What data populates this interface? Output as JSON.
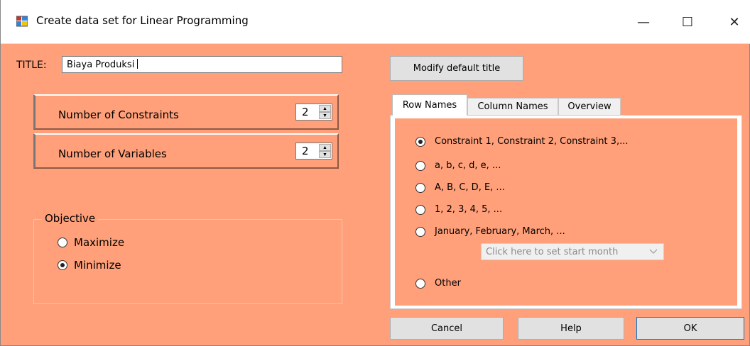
{
  "window": {
    "title": "Create data set for Linear Programming",
    "controls": {
      "minimize": "—",
      "maximize": "☐",
      "close": "✕"
    }
  },
  "title_field": {
    "label": "TITLE:",
    "value": "Biaya Produksi"
  },
  "modify_button": "Modify default title",
  "constraints": {
    "label": "Number of Constraints",
    "value": "2"
  },
  "variables": {
    "label": "Number of Variables",
    "value": "2"
  },
  "objective": {
    "legend": "Objective",
    "options": [
      {
        "label": "Maximize",
        "selected": false
      },
      {
        "label": "Minimize",
        "selected": true
      }
    ]
  },
  "tabs": [
    {
      "label": "Row Names",
      "active": true
    },
    {
      "label": "Column Names",
      "active": false
    },
    {
      "label": "Overview",
      "active": false
    }
  ],
  "row_names": {
    "options": [
      {
        "label": "Constraint 1, Constraint 2, Constraint 3,...",
        "selected": true
      },
      {
        "label": "a, b, c, d, e, ...",
        "selected": false
      },
      {
        "label": "A, B, C, D, E, ...",
        "selected": false
      },
      {
        "label": "1, 2, 3, 4, 5, ...",
        "selected": false
      },
      {
        "label": "January, February, March, ...",
        "selected": false
      },
      {
        "label": "Other",
        "selected": false
      }
    ],
    "start_month_combo": "Click here to set start month"
  },
  "footer": {
    "cancel": "Cancel",
    "help": "Help",
    "ok": "OK"
  },
  "colors": {
    "background": "#ffa07a",
    "button": "#e1e1e1",
    "ok_border": "#0078d7"
  }
}
